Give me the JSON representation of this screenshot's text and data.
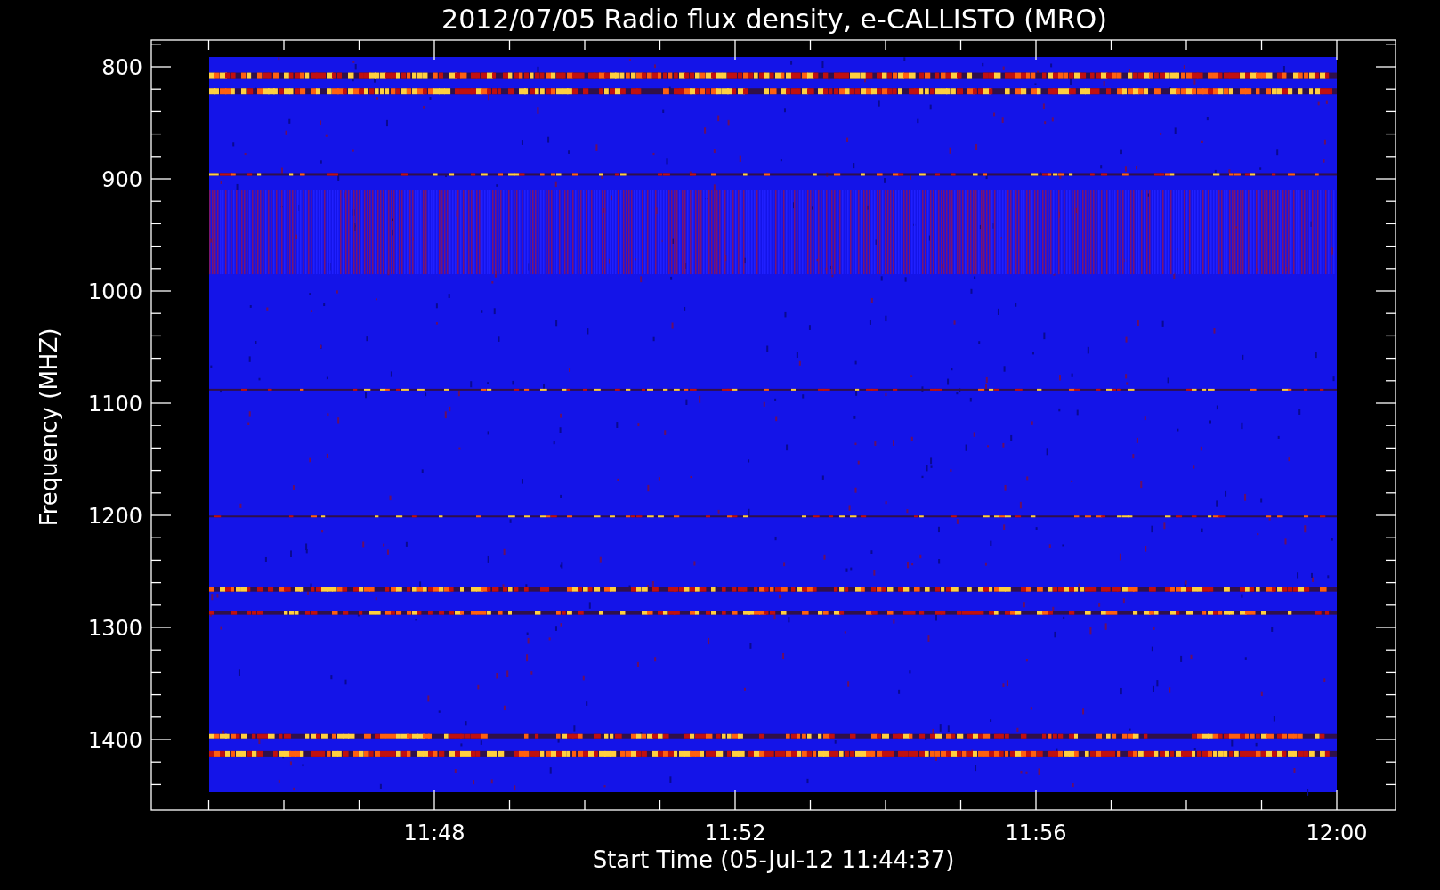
{
  "title": "2012/07/05  Radio flux density, e-CALLISTO (MRO)",
  "y_axis": {
    "label": "Frequency (MHZ)",
    "ticks": [
      "800",
      "900",
      "1000",
      "1100",
      "1200",
      "1300",
      "1400"
    ]
  },
  "x_axis": {
    "label": "Start Time (05-Jul-12 11:44:37)",
    "ticks": [
      "11:48",
      "11:52",
      "11:56",
      "12:00"
    ]
  }
}
